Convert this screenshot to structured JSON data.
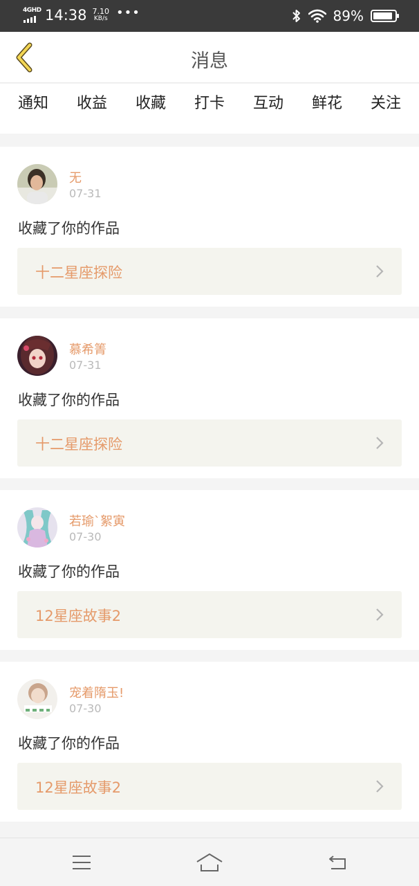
{
  "status_bar": {
    "network_label": "4GHD",
    "time": "14:38",
    "speed_value": "7.10",
    "speed_unit": "KB/s",
    "more": "•••",
    "battery_percent": "89%",
    "battery_level": 0.89
  },
  "header": {
    "title": "消息",
    "accent_color": "#e472a8"
  },
  "tabs": [
    {
      "label": "通知",
      "active": false
    },
    {
      "label": "收益",
      "active": false
    },
    {
      "label": "收藏",
      "active": true
    },
    {
      "label": "打卡",
      "active": false
    },
    {
      "label": "互动",
      "active": false
    },
    {
      "label": "鲜花",
      "active": false
    },
    {
      "label": "关注",
      "active": false
    }
  ],
  "feed": [
    {
      "username": "无",
      "date": "07-31",
      "action": "收藏了你的作品",
      "work_title": "十二星座探险",
      "avatar_icon": "avatar-photo"
    },
    {
      "username": "慕希箐",
      "date": "07-31",
      "action": "收藏了你的作品",
      "work_title": "十二星座探险",
      "avatar_icon": "avatar-anime-girl"
    },
    {
      "username": "若瑜`絮寅",
      "date": "07-30",
      "action": "收藏了你的作品",
      "work_title": "12星座故事2",
      "avatar_icon": "avatar-anime-teal"
    },
    {
      "username": "宠着隋玉!",
      "date": "07-30",
      "action": "收藏了你的作品",
      "work_title": "12星座故事2",
      "avatar_icon": "avatar-photo-light"
    }
  ],
  "nav": {
    "menu_icon": "menu-icon",
    "home_icon": "home-icon",
    "back_icon": "back-icon"
  }
}
